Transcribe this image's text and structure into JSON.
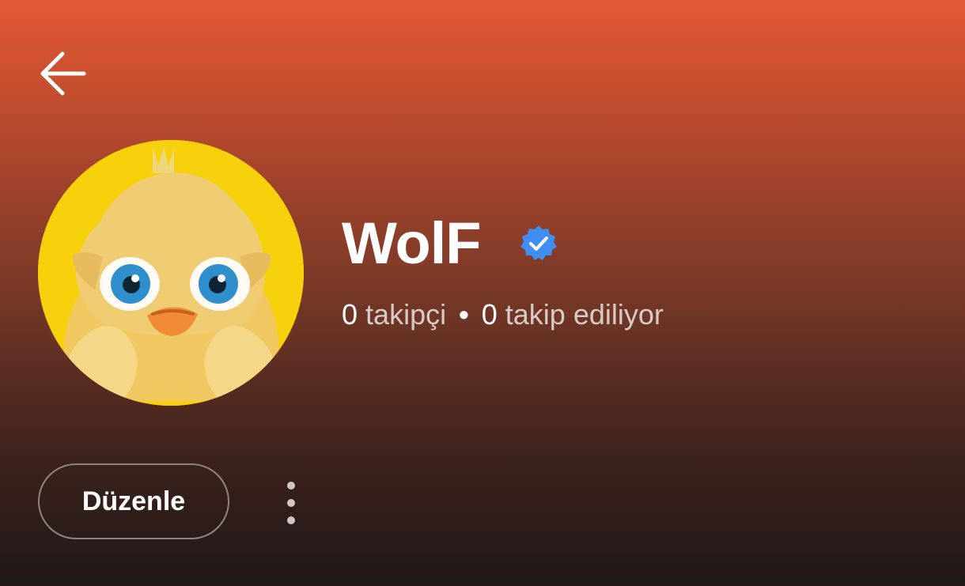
{
  "header": {
    "back_icon": "arrow-left-icon"
  },
  "profile": {
    "name": "WolF",
    "verified_icon": "verified-badge-icon",
    "avatar_icon": "chick-avatar",
    "followers_count": "0",
    "followers_label": "takipçi",
    "separator": "•",
    "following_count": "0",
    "following_label": "takip ediliyor"
  },
  "actions": {
    "edit_label": "Düzenle",
    "more_icon": "more-vertical-icon"
  },
  "colors": {
    "top_gradient": "#e45834",
    "bottom_gradient": "#1f1817",
    "avatar_background": "#f6d10b",
    "verified_badge": "#3f8ef2"
  }
}
